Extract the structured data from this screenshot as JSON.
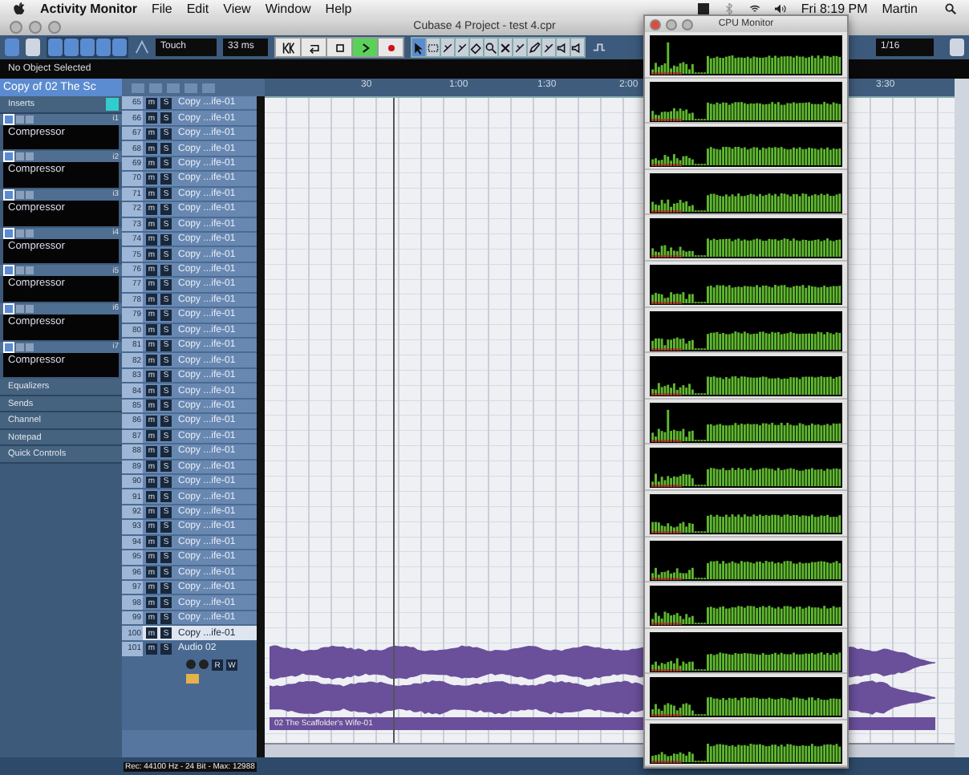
{
  "menubar": {
    "app": "Activity Monitor",
    "menus": [
      "File",
      "Edit",
      "View",
      "Window",
      "Help"
    ],
    "clock": "Fri 8:19 PM",
    "user": "Martin"
  },
  "window": {
    "title": "Cubase 4 Project - test 4.cpr"
  },
  "toolbar": {
    "automation_mode": "Touch",
    "latency": "33 ms",
    "quantize": "1/16",
    "transport": [
      {
        "kind": "locate",
        "selected": false
      },
      {
        "kind": "cycle",
        "selected": false
      },
      {
        "kind": "stop",
        "selected": false
      },
      {
        "kind": "play",
        "selected": true
      },
      {
        "kind": "record",
        "selected": false
      }
    ],
    "tools": [
      {
        "kind": "arrow",
        "selected": true
      },
      {
        "kind": "range",
        "selected": false
      },
      {
        "kind": "split",
        "selected": false
      },
      {
        "kind": "glue",
        "selected": false
      },
      {
        "kind": "erase",
        "selected": false
      },
      {
        "kind": "zoom",
        "selected": false
      },
      {
        "kind": "mute",
        "selected": false
      },
      {
        "kind": "time",
        "selected": false
      },
      {
        "kind": "draw",
        "selected": false
      },
      {
        "kind": "line",
        "selected": false
      },
      {
        "kind": "play",
        "selected": false
      },
      {
        "kind": "comp",
        "selected": false
      }
    ]
  },
  "info_line": "No Object Selected",
  "inspector": {
    "track_name": "Copy of 02 The Sc",
    "inserts_label": "Inserts",
    "slots": [
      {
        "label": "i1",
        "plugin": "Compressor"
      },
      {
        "label": "i2",
        "plugin": "Compressor"
      },
      {
        "label": "i3",
        "plugin": "Compressor"
      },
      {
        "label": "i4",
        "plugin": "Compressor"
      },
      {
        "label": "i5",
        "plugin": "Compressor"
      },
      {
        "label": "i6",
        "plugin": "Compressor"
      },
      {
        "label": "i7",
        "plugin": "Compressor"
      }
    ],
    "sections": [
      {
        "label": "Equalizers"
      },
      {
        "label": "Sends"
      },
      {
        "label": "Channel"
      },
      {
        "label": "Notepad"
      },
      {
        "label": "Quick Controls"
      }
    ]
  },
  "ruler": {
    "marks": [
      "30",
      "1:00",
      "1:30",
      "2:00",
      "3:30"
    ]
  },
  "tracks": [
    {
      "number": "65",
      "mute": "m",
      "solo": "S",
      "name": "Copy ...ife-01",
      "selected": false
    },
    {
      "number": "66",
      "mute": "m",
      "solo": "S",
      "name": "Copy ...ife-01",
      "selected": false
    },
    {
      "number": "67",
      "mute": "m",
      "solo": "S",
      "name": "Copy ...ife-01",
      "selected": false
    },
    {
      "number": "68",
      "mute": "m",
      "solo": "S",
      "name": "Copy ...ife-01",
      "selected": false
    },
    {
      "number": "69",
      "mute": "m",
      "solo": "S",
      "name": "Copy ...ife-01",
      "selected": false
    },
    {
      "number": "70",
      "mute": "m",
      "solo": "S",
      "name": "Copy ...ife-01",
      "selected": false
    },
    {
      "number": "71",
      "mute": "m",
      "solo": "S",
      "name": "Copy ...ife-01",
      "selected": false
    },
    {
      "number": "72",
      "mute": "m",
      "solo": "S",
      "name": "Copy ...ife-01",
      "selected": false
    },
    {
      "number": "73",
      "mute": "m",
      "solo": "S",
      "name": "Copy ...ife-01",
      "selected": false
    },
    {
      "number": "74",
      "mute": "m",
      "solo": "S",
      "name": "Copy ...ife-01",
      "selected": false
    },
    {
      "number": "75",
      "mute": "m",
      "solo": "S",
      "name": "Copy ...ife-01",
      "selected": false
    },
    {
      "number": "76",
      "mute": "m",
      "solo": "S",
      "name": "Copy ...ife-01",
      "selected": false
    },
    {
      "number": "77",
      "mute": "m",
      "solo": "S",
      "name": "Copy ...ife-01",
      "selected": false
    },
    {
      "number": "78",
      "mute": "m",
      "solo": "S",
      "name": "Copy ...ife-01",
      "selected": false
    },
    {
      "number": "79",
      "mute": "m",
      "solo": "S",
      "name": "Copy ...ife-01",
      "selected": false
    },
    {
      "number": "80",
      "mute": "m",
      "solo": "S",
      "name": "Copy ...ife-01",
      "selected": false
    },
    {
      "number": "81",
      "mute": "m",
      "solo": "S",
      "name": "Copy ...ife-01",
      "selected": false
    },
    {
      "number": "82",
      "mute": "m",
      "solo": "S",
      "name": "Copy ...ife-01",
      "selected": false
    },
    {
      "number": "83",
      "mute": "m",
      "solo": "S",
      "name": "Copy ...ife-01",
      "selected": false
    },
    {
      "number": "84",
      "mute": "m",
      "solo": "S",
      "name": "Copy ...ife-01",
      "selected": false
    },
    {
      "number": "85",
      "mute": "m",
      "solo": "S",
      "name": "Copy ...ife-01",
      "selected": false
    },
    {
      "number": "86",
      "mute": "m",
      "solo": "S",
      "name": "Copy ...ife-01",
      "selected": false
    },
    {
      "number": "87",
      "mute": "m",
      "solo": "S",
      "name": "Copy ...ife-01",
      "selected": false
    },
    {
      "number": "88",
      "mute": "m",
      "solo": "S",
      "name": "Copy ...ife-01",
      "selected": false
    },
    {
      "number": "89",
      "mute": "m",
      "solo": "S",
      "name": "Copy ...ife-01",
      "selected": false
    },
    {
      "number": "90",
      "mute": "m",
      "solo": "S",
      "name": "Copy ...ife-01",
      "selected": false
    },
    {
      "number": "91",
      "mute": "m",
      "solo": "S",
      "name": "Copy ...ife-01",
      "selected": false
    },
    {
      "number": "92",
      "mute": "m",
      "solo": "S",
      "name": "Copy ...ife-01",
      "selected": false
    },
    {
      "number": "93",
      "mute": "m",
      "solo": "S",
      "name": "Copy ...ife-01",
      "selected": false
    },
    {
      "number": "94",
      "mute": "m",
      "solo": "S",
      "name": "Copy ...ife-01",
      "selected": false
    },
    {
      "number": "95",
      "mute": "m",
      "solo": "S",
      "name": "Copy ...ife-01",
      "selected": false
    },
    {
      "number": "96",
      "mute": "m",
      "solo": "S",
      "name": "Copy ...ife-01",
      "selected": false
    },
    {
      "number": "97",
      "mute": "m",
      "solo": "S",
      "name": "Copy ...ife-01",
      "selected": false
    },
    {
      "number": "98",
      "mute": "m",
      "solo": "S",
      "name": "Copy ...ife-01",
      "selected": false
    },
    {
      "number": "99",
      "mute": "m",
      "solo": "S",
      "name": "Copy ...ife-01",
      "selected": false
    },
    {
      "number": "100",
      "mute": "m",
      "solo": "S",
      "name": "Copy ...ife-01",
      "selected": true
    }
  ],
  "audio_track": {
    "number": "101",
    "mute": "m",
    "solo": "S",
    "name": "Audio 02",
    "read": "R",
    "write": "W",
    "region": "02 The Scaffolder's Wife-01"
  },
  "status": "Rec: 44100 Hz - 24 Bit - Max: 12988",
  "cpu_monitor": {
    "title": "CPU Monitor"
  }
}
